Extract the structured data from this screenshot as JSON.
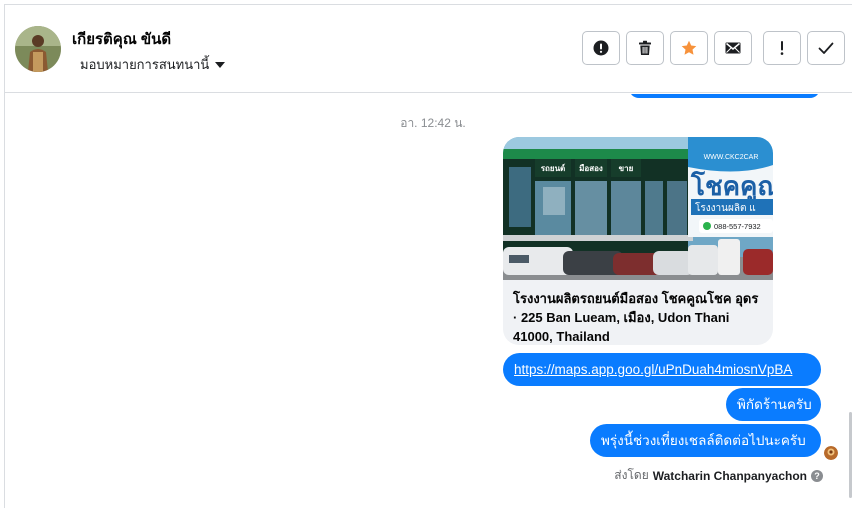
{
  "header": {
    "contact_name": "เกียรติคุณ ขันดี",
    "assign_label": "มอบหมายการสนทนานี้",
    "actions": [
      {
        "name": "spam-button",
        "icon": "alert-circle-icon"
      },
      {
        "name": "delete-button",
        "icon": "trash-icon"
      },
      {
        "name": "star-button",
        "icon": "star-icon"
      },
      {
        "name": "mark-unread-button",
        "icon": "envelope-icon"
      },
      {
        "name": "follow-up-button",
        "icon": "exclamation-icon"
      },
      {
        "name": "mark-done-button",
        "icon": "check-icon"
      }
    ],
    "star_color": "#f7923b"
  },
  "thread": {
    "timestamp": "อา. 12:42 น.",
    "link_card": {
      "image_sign_main": "โชคคูณ",
      "image_sign_sub": "โรงงานผลิต แ",
      "image_url_text": "WWW.CKC2CAR",
      "image_phone": "088-557-7932",
      "image_store_sign_1": "รถยนต์",
      "image_store_sign_2": "มือสอง",
      "image_store_sign_3": "ขาย",
      "title": "โรงงานผลิตรถยนต์มือสอง โชคคูณโชค อุดร · 225 Ban Lueam, เมือง, Udon Thani 41000, Thailand"
    },
    "messages": [
      {
        "text": "https://maps.app.goo.gl/uPnDuah4miosnVpBA",
        "is_link": true
      },
      {
        "text": "พิกัดร้านครับ",
        "is_link": false
      },
      {
        "text": "พรุ่งนี้ช่วงเที่ยงเชลล์ติดต่อไปนะครับ",
        "is_link": false
      }
    ],
    "sent_by_prefix": "ส่งโดย",
    "sent_by_name": "Watcharin Chanpanyachon",
    "bubble_color": "#0a7cff"
  }
}
